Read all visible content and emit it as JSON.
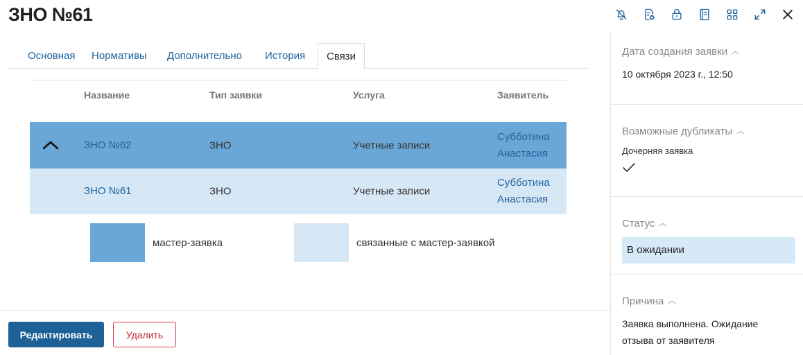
{
  "title": "ЗНО №61",
  "icons": [
    "bell-off-icon",
    "document-add-icon",
    "lock-icon",
    "book-icon",
    "grid-icon",
    "expand-icon",
    "close-icon"
  ],
  "tabs": [
    {
      "label": "Основная",
      "active": false
    },
    {
      "label": "Нормативы",
      "active": false
    },
    {
      "label": "Дополнительно",
      "active": false
    },
    {
      "label": "История",
      "active": false
    },
    {
      "label": "Связи",
      "active": true
    }
  ],
  "table": {
    "columns": [
      "Название",
      "Тип заявки",
      "Услуга",
      "Заявитель"
    ],
    "rows": [
      {
        "name": "ЗНО №62",
        "type": "ЗНО",
        "service": "Учетные записи",
        "applicant_line1": "Субботина",
        "applicant_line2": "Анастасия",
        "kind": "master"
      },
      {
        "name": "ЗНО №61",
        "type": "ЗНО",
        "service": "Учетные записи",
        "applicant_line1": "Субботина",
        "applicant_line2": "Анастасия",
        "kind": "linked"
      }
    ]
  },
  "legend": {
    "master_label": "мастер-заявка",
    "master_color": "#6aa7d6",
    "linked_label": "связанные с мастер-заявкой",
    "linked_color": "#d6e7f5"
  },
  "buttons": {
    "edit": "Редактировать",
    "delete": "Удалить"
  },
  "sidebar": {
    "created": {
      "header": "Дата создания заявки",
      "value": "10 октября 2023 г., 12:50"
    },
    "duplicates": {
      "header": "Возможные дубликаты",
      "sub_label": "Дочерняя заявка",
      "checked": true
    },
    "status": {
      "header": "Статус",
      "value": "В ожидании"
    },
    "reason": {
      "header": "Причина",
      "value": "Заявка выполнена. Ожидание отзыва от заявителя"
    }
  },
  "colors": {
    "accent": "#1e6196",
    "link": "#2164a0",
    "danger": "#c5222d"
  }
}
